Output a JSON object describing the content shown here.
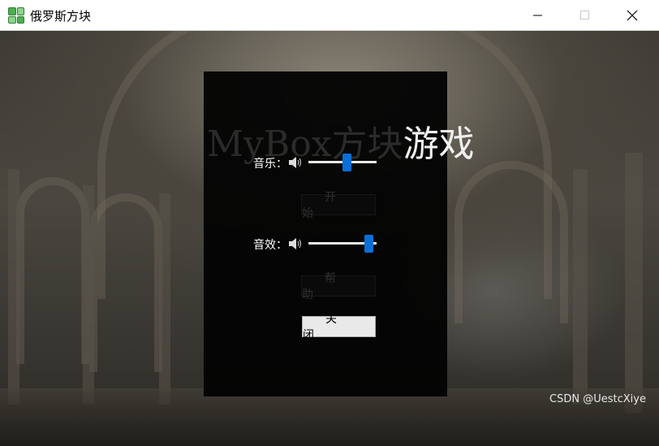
{
  "window": {
    "title": "俄罗斯方块",
    "icon": "tetris-app-icon",
    "controls": [
      "minimize-icon",
      "maximize-icon",
      "close-icon"
    ]
  },
  "game": {
    "title_dim": "MyBox方块",
    "title_bright": "游戏"
  },
  "controls": {
    "music": {
      "label": "音乐：",
      "icon": "speaker-icon",
      "level": 0.57
    },
    "start_button": "开 始",
    "sound_effect": {
      "label": "音效：",
      "icon": "speaker-icon",
      "level": 0.94
    },
    "help_button": "帮 助",
    "close_button": "关 闭"
  },
  "watermark": "CSDN @UestcXiye",
  "colors": {
    "accent": "#0a6fd6",
    "panel": "#030303"
  }
}
